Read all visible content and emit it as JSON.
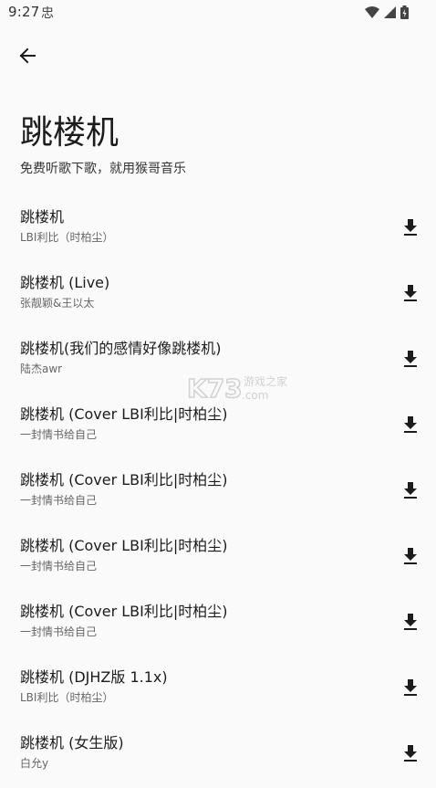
{
  "status_bar": {
    "time": "9:27",
    "app_icon": "忠",
    "icons": [
      "wifi-icon",
      "signal-icon",
      "battery-icon"
    ]
  },
  "header": {
    "back_icon": "arrow-left-icon",
    "title": "跳楼机",
    "subtitle": "免费听歌下歌，就用猴哥音乐"
  },
  "songs": [
    {
      "title": "跳楼机",
      "artist": "LBI利比（时柏尘）"
    },
    {
      "title": "跳楼机 (Live)",
      "artist": "张靓颖&王以太"
    },
    {
      "title": "跳楼机(我们的感情好像跳楼机)",
      "artist": "陆杰awr"
    },
    {
      "title": "跳楼机 (Cover LBI利比|时柏尘)",
      "artist": "一封情书给自己"
    },
    {
      "title": "跳楼机 (Cover LBI利比|时柏尘)",
      "artist": "一封情书给自己"
    },
    {
      "title": "跳楼机 (Cover LBI利比|时柏尘)",
      "artist": "一封情书给自己"
    },
    {
      "title": "跳楼机 (Cover LBI利比|时柏尘)",
      "artist": "一封情书给自己"
    },
    {
      "title": "跳楼机 (DJHZ版 1.1x)",
      "artist": "LBI利比（时柏尘）"
    },
    {
      "title": "跳楼机 (女生版)",
      "artist": "白允y"
    }
  ],
  "download_icon": "download-icon",
  "watermark": {
    "logo": "K73",
    "text": "游戏之家",
    "domain": ".com"
  },
  "colors": {
    "background": "#fafafa",
    "text_primary": "#1c1c1c",
    "text_secondary": "#666666"
  }
}
